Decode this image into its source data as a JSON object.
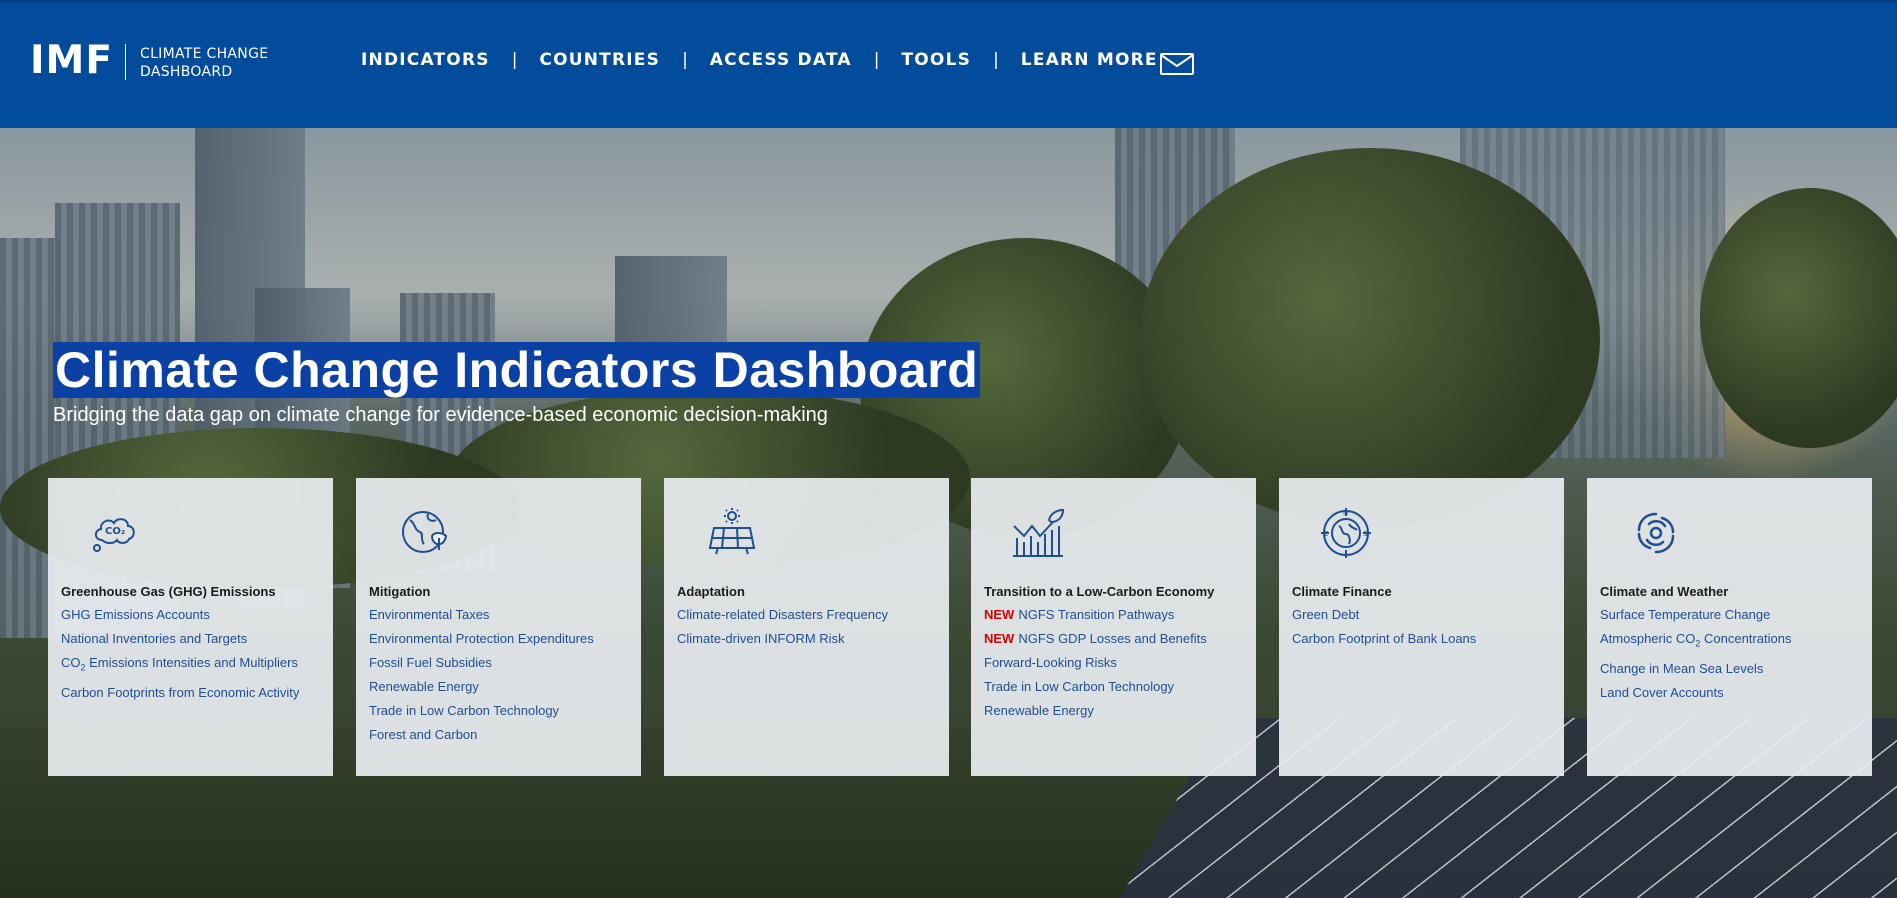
{
  "header": {
    "logo_text": "IMF",
    "logo_sub_line1": "CLIMATE CHANGE",
    "logo_sub_line2": "DASHBOARD",
    "nav": [
      "INDICATORS",
      "COUNTRIES",
      "ACCESS DATA",
      "TOOLS",
      "LEARN MORE"
    ],
    "nav_separator": "|",
    "mail_icon": "envelope-icon"
  },
  "hero": {
    "title": "Climate Change Indicators Dashboard",
    "subtitle": "Bridging the data gap on climate change for evidence-based economic decision-making"
  },
  "colors": {
    "header_bg": "#034c9c",
    "title_highlight": "#0b40a5",
    "link": "#1e4f91",
    "new_badge": "#d50000"
  },
  "cards": [
    {
      "icon": "co2-cloud-icon",
      "title": "Greenhouse Gas (GHG) Emissions",
      "links": [
        {
          "text": "GHG Emissions Accounts"
        },
        {
          "text": "National Inventories and Targets"
        },
        {
          "prefix": "CO",
          "sub": "2",
          "text": " Emissions Intensities and Multipliers"
        },
        {
          "text": "Carbon Footprints from Economic Activity"
        }
      ]
    },
    {
      "icon": "globe-leaf-icon",
      "title": "Mitigation",
      "links": [
        {
          "text": "Environmental Taxes"
        },
        {
          "text": "Environmental Protection Expenditures"
        },
        {
          "text": "Fossil Fuel Subsidies"
        },
        {
          "text": "Renewable Energy"
        },
        {
          "text": "Trade in Low Carbon Technology"
        },
        {
          "text": "Forest and Carbon"
        }
      ]
    },
    {
      "icon": "solar-panel-icon",
      "title": "Adaptation",
      "links": [
        {
          "text": "Climate-related Disasters Frequency"
        },
        {
          "text": "Climate-driven INFORM Risk"
        }
      ]
    },
    {
      "icon": "growth-chart-leaf-icon",
      "title": "Transition to a Low-Carbon Economy",
      "links": [
        {
          "new": "NEW",
          "text": "NGFS Transition Pathways"
        },
        {
          "new": "NEW",
          "text": "NGFS GDP Losses and Benefits"
        },
        {
          "text": "Forward-Looking Risks"
        },
        {
          "text": "Trade in Low Carbon Technology"
        },
        {
          "text": "Renewable Energy"
        }
      ]
    },
    {
      "icon": "compass-globe-icon",
      "title": "Climate Finance",
      "links": [
        {
          "text": "Green Debt"
        },
        {
          "text": "Carbon Footprint of Bank Loans"
        }
      ]
    },
    {
      "icon": "hurricane-icon",
      "title": "Climate and Weather",
      "links": [
        {
          "text": "Surface Temperature Change"
        },
        {
          "prefix": "Atmospheric CO",
          "sub": "2",
          "text": " Concentrations"
        },
        {
          "text": "Change in Mean Sea Levels"
        },
        {
          "text": "Land Cover Accounts"
        }
      ]
    }
  ]
}
